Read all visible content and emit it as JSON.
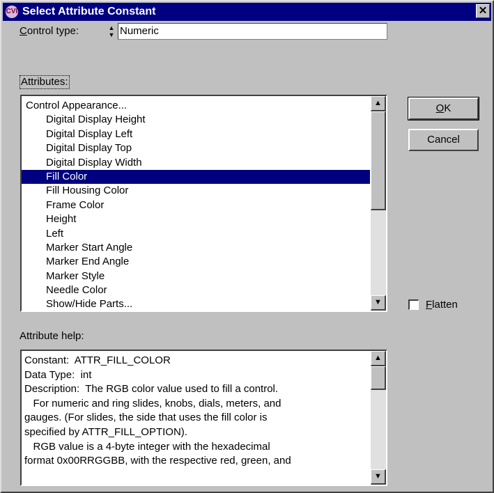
{
  "window": {
    "title": "Select Attribute Constant",
    "app_icon_text": "CVI",
    "close_glyph": "✕"
  },
  "control_type": {
    "label_prefix": "",
    "label_accel": "C",
    "label_rest": "ontrol type:",
    "value": "Numeric",
    "spin_up": "▲",
    "spin_down": "▼"
  },
  "attributes": {
    "label": "Attributes:",
    "items": [
      {
        "label": "Control Appearance...",
        "indent": false,
        "selected": false
      },
      {
        "label": "Digital Display Height",
        "indent": true,
        "selected": false
      },
      {
        "label": "Digital Display Left",
        "indent": true,
        "selected": false
      },
      {
        "label": "Digital Display Top",
        "indent": true,
        "selected": false
      },
      {
        "label": "Digital Display Width",
        "indent": true,
        "selected": false
      },
      {
        "label": "Fill Color",
        "indent": true,
        "selected": true
      },
      {
        "label": "Fill Housing Color",
        "indent": true,
        "selected": false
      },
      {
        "label": "Frame Color",
        "indent": true,
        "selected": false
      },
      {
        "label": "Height",
        "indent": true,
        "selected": false
      },
      {
        "label": "Left",
        "indent": true,
        "selected": false
      },
      {
        "label": "Marker Start Angle",
        "indent": true,
        "selected": false
      },
      {
        "label": "Marker End Angle",
        "indent": true,
        "selected": false
      },
      {
        "label": "Marker Style",
        "indent": true,
        "selected": false
      },
      {
        "label": "Needle Color",
        "indent": true,
        "selected": false
      },
      {
        "label": "Show/Hide Parts...",
        "indent": true,
        "selected": false
      }
    ],
    "scroll_up": "▲",
    "scroll_down": "▼"
  },
  "buttons": {
    "ok_accel": "O",
    "ok_rest": "K",
    "cancel": "Cancel"
  },
  "flatten": {
    "accel": "F",
    "rest": "latten",
    "checked": false
  },
  "help": {
    "label": "Attribute help:",
    "lines": [
      "Constant:  ATTR_FILL_COLOR",
      "Data Type:  int",
      "Description:  The RGB color value used to fill a control.",
      "   For numeric and ring slides, knobs, dials, meters, and",
      "gauges. (For slides, the side that uses the fill color is",
      "specified by ATTR_FILL_OPTION).",
      "   RGB value is a 4-byte integer with the hexadecimal",
      "format 0x00RRGGBB, with the respective red, green, and"
    ],
    "scroll_up": "▲",
    "scroll_down": "▼"
  },
  "colors": {
    "titlebar": "#000080",
    "face": "#c0c0c0",
    "selection": "#000080"
  }
}
